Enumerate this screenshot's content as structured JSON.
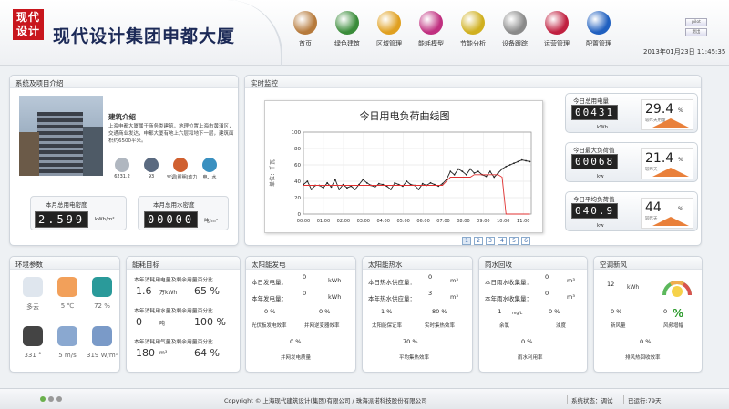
{
  "header": {
    "logo_text": "现代设计",
    "title": "现代设计集团申都大厦",
    "datetime": "2013年01月23日 11:45:35",
    "btn_top": "pilot",
    "btn_bottom": "退出",
    "nav": [
      {
        "label": "首页",
        "icon": "home-icon",
        "color": "#b67a3c"
      },
      {
        "label": "绿色建筑",
        "icon": "green-building-icon",
        "color": "#3a8c3a"
      },
      {
        "label": "区域管理",
        "icon": "region-icon",
        "color": "#e0a020"
      },
      {
        "label": "能耗模型",
        "icon": "molecule-icon",
        "color": "#c03080"
      },
      {
        "label": "节能分析",
        "icon": "pencil-ruler-icon",
        "color": "#d0b020"
      },
      {
        "label": "设备跟踪",
        "icon": "device-icon",
        "color": "#8a8a8a"
      },
      {
        "label": "运营管理",
        "icon": "operation-icon",
        "color": "#c02040"
      },
      {
        "label": "配置管理",
        "icon": "gear-icon",
        "color": "#2060c0"
      }
    ]
  },
  "intro": {
    "panel_title": "系统及项目介绍",
    "heading": "建筑介绍",
    "text": "上海申都大厦属于商务类建筑，地理位置上海市黄浦区，交通商业发达，申都大厦有地上六层和地下一层，建筑面积约6500平米。",
    "icons": [
      {
        "name": "building-icon",
        "value": "6231.2"
      },
      {
        "name": "people-icon",
        "value": "93"
      },
      {
        "name": "hvac-icon",
        "value": "空调|照明|动力"
      },
      {
        "name": "water-electric-icon",
        "value": "电、水"
      }
    ],
    "elec_label": "本月总用电密度",
    "elec_value": "2.599",
    "elec_unit": "kWh/m²",
    "water_label": "本月总用水密度",
    "water_value": "00000",
    "water_unit": "吨/m²"
  },
  "monitor": {
    "panel_title": "实时监控",
    "pages": [
      "1",
      "2",
      "3",
      "4",
      "5",
      "6"
    ],
    "cards": [
      {
        "label": "今日总用电量",
        "value": "00431",
        "unit": "kWh",
        "pct": "29.4",
        "pct_unit": "%",
        "sub": "较昨天用量"
      },
      {
        "label": "今日最大负荷值",
        "value": "00068",
        "unit": "kw",
        "pct": "21.4",
        "pct_unit": "%",
        "sub": "较昨天"
      },
      {
        "label": "今日平均负荷值",
        "value": "040.9",
        "unit": "kw",
        "pct": "44",
        "pct_unit": "%",
        "sub": "较昨天"
      }
    ]
  },
  "chart_data": {
    "type": "line",
    "title": "今日用电负荷曲线图",
    "ylabel": "单位：千瓦",
    "ylim": [
      0,
      100
    ],
    "yticks": [
      0,
      20,
      40,
      60,
      80,
      100
    ],
    "categories": [
      "00:00",
      "01:00",
      "02:00",
      "03:00",
      "04:00",
      "05:00",
      "06:00",
      "07:00",
      "08:00",
      "09:00",
      "10:00",
      "11:00"
    ],
    "series": [
      {
        "color": "#222222",
        "values": [
          36,
          40,
          30,
          35,
          35,
          32,
          38,
          33,
          42,
          30,
          36,
          32,
          34,
          30,
          36,
          42,
          38,
          35,
          33,
          37,
          36,
          34,
          30,
          38,
          36,
          34,
          40,
          36,
          35,
          30,
          37,
          35,
          38,
          36,
          34,
          37,
          42,
          52,
          48,
          55,
          52,
          48,
          55,
          50,
          52,
          48,
          46,
          52,
          45,
          50,
          55,
          58,
          60,
          62,
          64,
          66,
          65,
          64
        ]
      },
      {
        "color": "#e03030",
        "values": [
          35,
          35,
          35,
          35,
          35,
          35,
          35,
          35,
          35,
          35,
          35,
          35,
          35,
          35,
          35,
          35,
          35,
          35,
          35,
          35,
          35,
          35,
          35,
          35,
          35,
          35,
          35,
          35,
          35,
          35,
          35,
          35,
          35,
          35,
          35,
          35,
          40,
          45,
          45,
          45,
          45,
          45,
          45,
          48,
          48,
          48,
          48,
          48,
          48,
          48,
          45,
          0,
          0,
          0,
          0,
          0,
          0,
          0
        ]
      }
    ]
  },
  "env": {
    "panel_title": "环境参数",
    "items": [
      {
        "icon": "cloud-icon",
        "value": "多云"
      },
      {
        "icon": "thermometer-icon",
        "value": "5 ℃"
      },
      {
        "icon": "humidity-icon",
        "value": "72 %"
      },
      {
        "icon": "wind-direction-icon",
        "value": "331 °"
      },
      {
        "icon": "wind-speed-icon",
        "value": "5 m/s"
      },
      {
        "icon": "radiation-icon",
        "value": "319 W/m²"
      }
    ]
  },
  "energy": {
    "panel_title": "能耗目标",
    "rows": [
      {
        "label": "本年消耗用电量及剩余用量百分比",
        "v1": "1.6",
        "u1": "万kWh",
        "v2": "65 %"
      },
      {
        "label": "本年消耗用水量及剩余用量百分比",
        "v1": "0",
        "u1": "吨",
        "v2": "100 %"
      },
      {
        "label": "本年消耗用气量及剩余用量百分比",
        "v1": "180",
        "u1": "m³",
        "v2": "64 %"
      }
    ]
  },
  "solar": {
    "panel_title": "太阳能发电",
    "r1_label": "本日发电量：",
    "r1_value": "0",
    "r1_unit": "kWh",
    "r2_label": "本年发电量：",
    "r2_value": "0",
    "r2_unit": "kWh",
    "p1": "0 %",
    "p1_label": "光伏板发电效率",
    "p2": "0 %",
    "p2_label": "并网逆变器效率",
    "p3": "0 %",
    "p3_label": "并网发电质量"
  },
  "heat": {
    "panel_title": "太阳能热水",
    "r1_label": "本日热水供应量：",
    "r1_value": "0",
    "r1_unit": "m³",
    "r2_label": "本年热水供应量：",
    "r2_value": "3",
    "r2_unit": "m³",
    "p1": "1 %",
    "p1_label": "太阳能保证率",
    "p2": "80 %",
    "p2_label": "实时集热效率",
    "p3": "70 %",
    "p3_label": "平均集热效率"
  },
  "rain": {
    "panel_title": "雨水回收",
    "r1_label": "本日雨水收集量：",
    "r1_value": "0",
    "r1_unit": "m³",
    "r2_label": "本年雨水收集量：",
    "r2_value": "0",
    "r2_unit": "m³",
    "p1": "-1",
    "p1_unit": "mg/L",
    "p1_label": "余氯",
    "p2": "0 %",
    "p2_label": "浊度",
    "p3": "0 %",
    "p3_label": "雨水利用率"
  },
  "air": {
    "panel_title": "空调新风",
    "v1": "12",
    "u1": "kWh",
    "p1": "0 %",
    "p1_label": "新风量",
    "p2": "0",
    "p2_unit": "%",
    "p2_label": "风频增幅",
    "p3": "0 %",
    "p3_label": "排风热回收效率"
  },
  "footer": {
    "copyright": "Copyright © 上海现代建筑设计(集团)有限公司 / 珠海派诺科技股份有限公司",
    "status": "系统状态：调试",
    "running": "已运行:79天"
  }
}
